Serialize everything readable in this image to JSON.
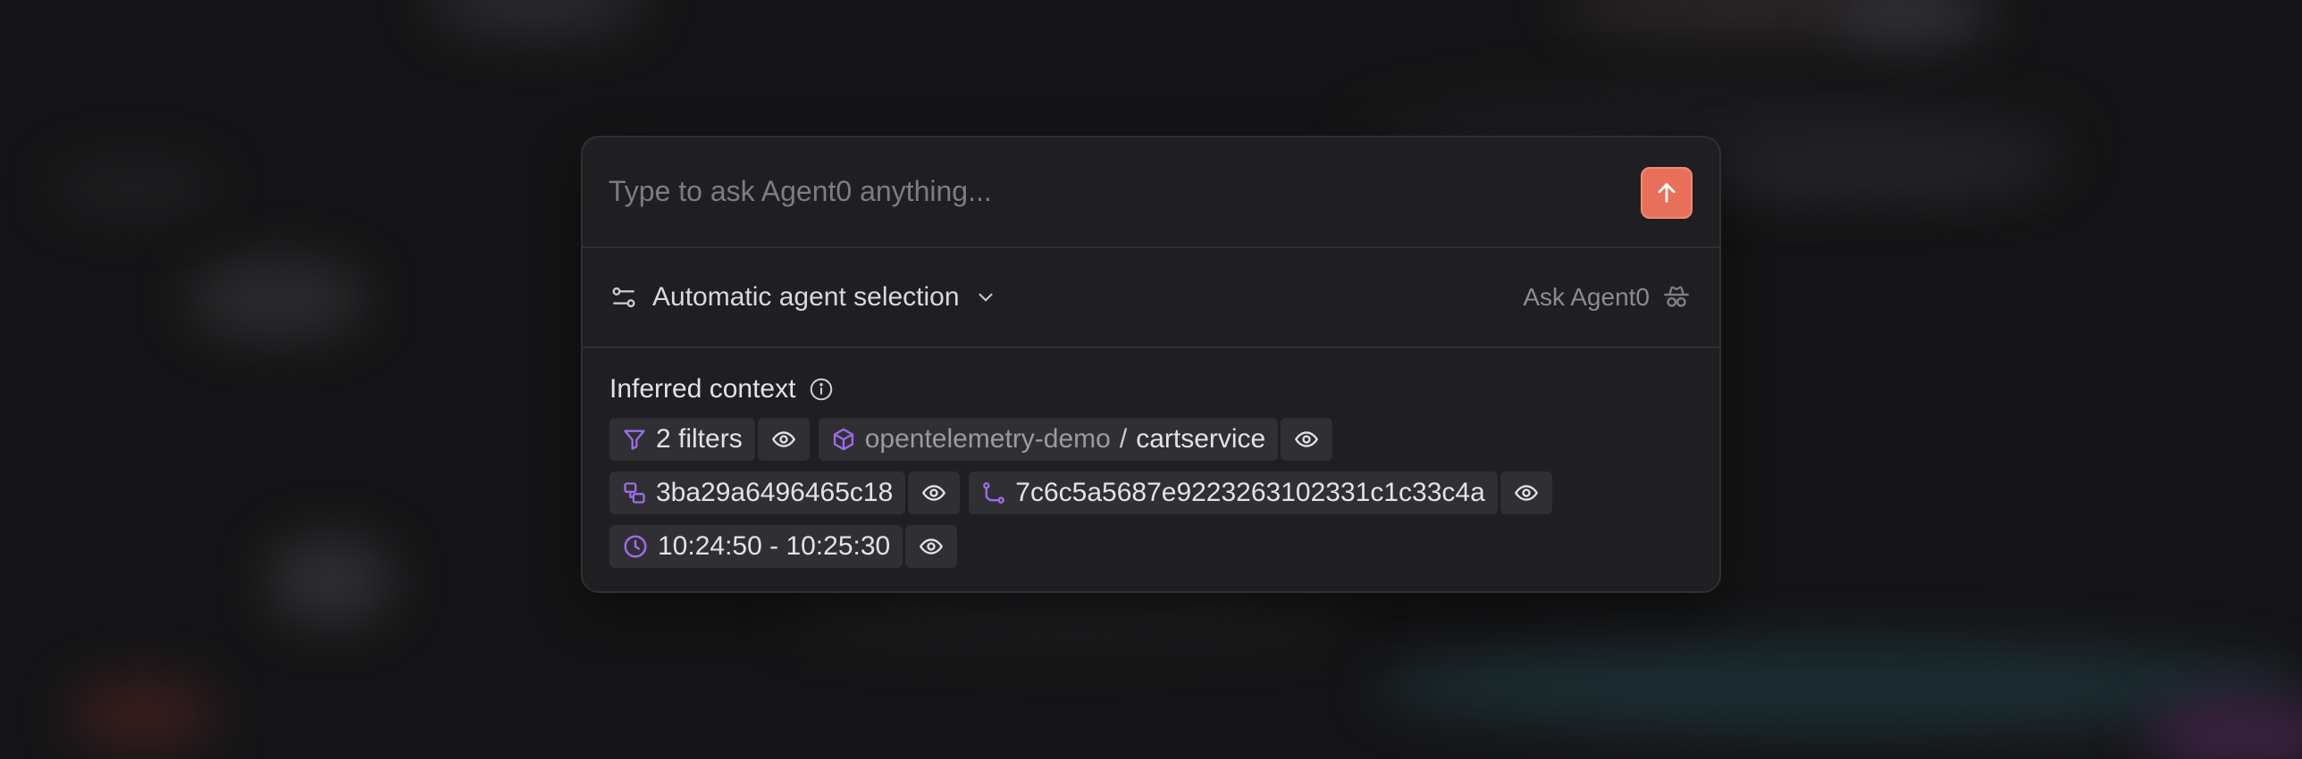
{
  "prompt": {
    "placeholder": "Type to ask Agent0 anything...",
    "value": ""
  },
  "send_button": {
    "icon": "arrow-up-icon",
    "color": "#e8705b"
  },
  "agent_selector": {
    "label": "Automatic agent selection",
    "icon": "sliders-icon"
  },
  "ask_agent": {
    "label": "Ask Agent0",
    "icon": "agent-spy-icon"
  },
  "context": {
    "title": "Inferred context",
    "accent": "#a06be8",
    "filters": {
      "label": "2 filters"
    },
    "service": {
      "namespace": "opentelemetry-demo",
      "separator": "/",
      "name": "cartservice"
    },
    "span": {
      "label": "3ba29a6496465c18"
    },
    "trace": {
      "label": "7c6c5a5687e9223263102331c1c33c4a"
    },
    "time_range": {
      "label": "10:24:50 - 10:25:30"
    }
  }
}
